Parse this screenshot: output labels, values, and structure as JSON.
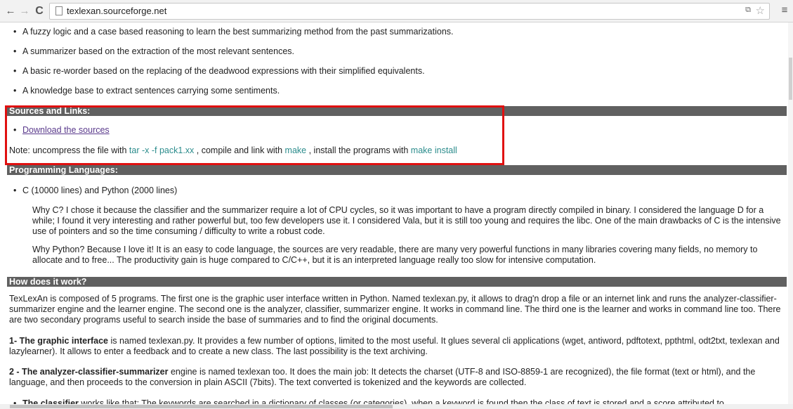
{
  "browser": {
    "back": "←",
    "forward": "→",
    "reload": "C",
    "url": "texlexan.sourceforge.net",
    "translate_icon": "translate-icon",
    "star_icon": "☆",
    "menu_icon": "≡"
  },
  "intro_bullets": [
    "A fuzzy logic and a case based reasoning to learn the best summarizing method from the past summarizations.",
    "A summarizer based on the extraction of the most relevant sentences.",
    "A basic re-worder based on the replacing of the deadwood expressions with their simplified equivalents.",
    "A knowledge base to extract sentences carrying some sentiments."
  ],
  "sources": {
    "header": "Sources and Links:",
    "download_link": "Download the sources",
    "note_prefix": "Note: uncompress the file with ",
    "cmd_tar": "tar -x -f pack1.xx",
    "note_mid1": " , compile and link with ",
    "cmd_make": "make",
    "note_mid2": " , install the programs with ",
    "cmd_install": "make install"
  },
  "languages": {
    "header": "Programming Languages:",
    "bullet": "C (10000 lines) and Python (2000 lines)",
    "why_c": "Why C? I chose it because the classifier and the summarizer require a lot of CPU cycles, so it was important to have a program directly compiled in binary. I considered the language D for a while; I found it very interesting and rather powerful but, too few developers use it. I considered Vala, but it is still too young and requires the libc. One of the main drawbacks of C is the intensive use of pointers and so the time consuming / difficulty to write a robust code.",
    "why_python": "Why Python? Because I love it! It is an easy to code language, the sources are very readable, there are many very powerful functions in many libraries covering many fields, no memory to allocate and to free... The productivity gain is huge compared to C/C++, but it is an interpreted language really too slow for intensive computation."
  },
  "how": {
    "header": "How does it work?",
    "intro": "TexLexAn is composed of 5 programs. The first one is the graphic user interface written in Python. Named texlexan.py, it allows to drag'n drop a file or an internet link and runs the analyzer-classifier-summarizer engine and the learner engine. The second one is the analyzer, classifier, summarizer engine. It works in command line. The third one is the learner and works in command line too. There are two secondary programs useful to search inside the base of summaries and to find the original documents.",
    "gui_title": "1- The graphic interface",
    "gui_text": " is named texlexan.py. It provides a few number of options, limited to the most useful. It glues several cli applications (wget, antiword, pdftotext, ppthtml, odt2txt, texlexan and lazylearner). It allows to enter a feedback and to create a new class. The last possibility is the text archiving.",
    "engine_title": "2 - The analyzer-classifier-summarizer",
    "engine_text": " engine is named texlexan too. It does the main job: It detects the charset (UTF-8 and ISO-8859-1 are recognized), the file format (text or html), and the language, and then proceeds to the conversion in plain ASCII (7bits). The text converted is tokenized and the keywords are collected.",
    "classifier_title": "The classifier",
    "classifier_text": " works like that: The keywords are searched in a dictionary of classes (or categories), when a keyword is found then the class of text is stored and a score attributed to"
  },
  "colors": {
    "header_bg": "#606060",
    "command": "#2b8c8c",
    "highlight": "#e01010"
  }
}
